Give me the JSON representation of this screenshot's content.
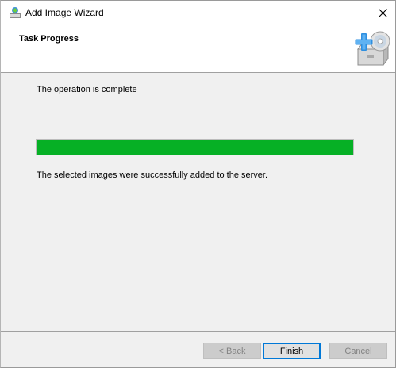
{
  "window": {
    "title": "Add Image Wizard",
    "close_icon": "close-icon",
    "app_icon": "wds-wizard-icon"
  },
  "header": {
    "title": "Task Progress",
    "graphic_icon": "add-image-disk-icon"
  },
  "content": {
    "status_text": "The operation is complete",
    "progress_percent": 100,
    "progress_color": "#06b025",
    "result_text": "The selected images were successfully added to the server."
  },
  "footer": {
    "back_label": "< Back",
    "finish_label": "Finish",
    "cancel_label": "Cancel"
  }
}
